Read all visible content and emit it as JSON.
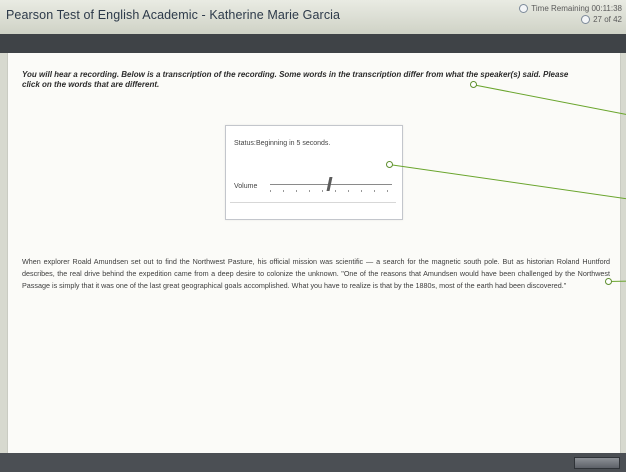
{
  "header": {
    "title": "Pearson Test of English Academic - Katherine Marie Garcia",
    "time_remaining": "Time Remaining 00:11:38",
    "question_counter": "27 of 42"
  },
  "instruction": "You will hear a recording. Below is a transcription of the recording. Some words in the transcription differ from what the speaker(s) said. Please click on the words that are different.",
  "player": {
    "status_label": "Status:",
    "status_value": "Beginning in 5 seconds.",
    "volume_label": "Volume",
    "volume_level": 0.48
  },
  "passage": "When explorer Roald Amundsen set out to find the Northwest Pasture, his official mission was scientific — a search for the magnetic south pole. But as historian Roland Huntford describes, the real drive behind the expedition came from a deep desire to colonize the unknown. \"One of the reasons that Amundsen would have been challenged by the Northwest Passage is simply that it was one of the last great geographical goals accomplished. What you have to realize is that by the 1880s, most of the earth had been discovered.\"",
  "colors": {
    "titlebar": "#dfe2d8",
    "toolbar": "#3f4347",
    "content_bg": "#fbfbf8",
    "pointer": "#6aa52d"
  }
}
